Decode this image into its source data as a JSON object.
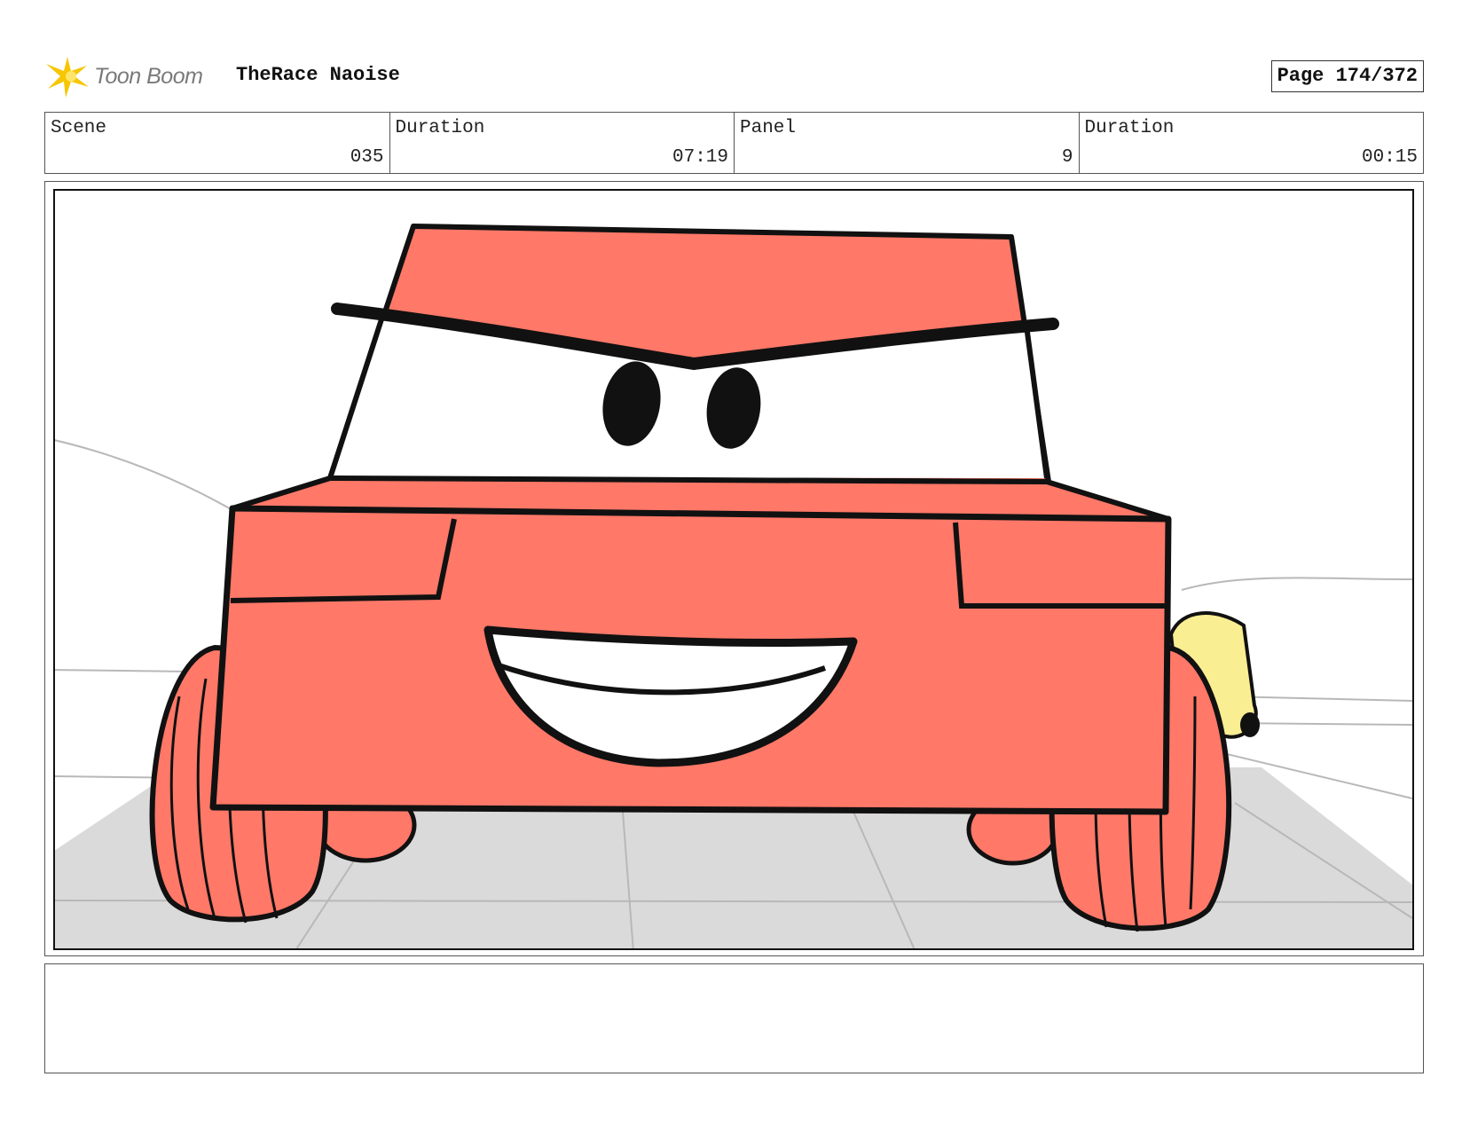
{
  "header": {
    "logo_text": "Toon Boom",
    "project_title": "TheRace Naoise",
    "page_label": "Page 174/372"
  },
  "info": [
    {
      "label": "Scene",
      "value": "035"
    },
    {
      "label": "Duration",
      "value": "07:19"
    },
    {
      "label": "Panel",
      "value": "9"
    },
    {
      "label": "Duration",
      "value": "00:15"
    }
  ],
  "colors": {
    "car_body": "#FF7868",
    "secondary_car": "#FAEE92",
    "floor": "#DADADA",
    "outline": "#111111"
  },
  "notes": ""
}
